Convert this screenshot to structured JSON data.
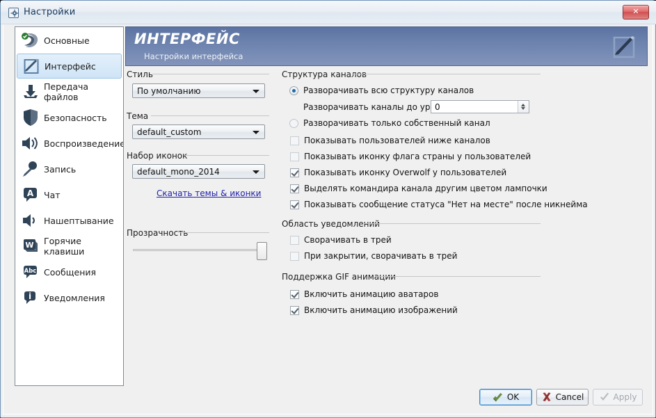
{
  "window": {
    "title": "Настройки",
    "title_icon": "settings-gear-icon",
    "close_label": "✕"
  },
  "sidebar": {
    "items": [
      {
        "label": "Основные",
        "icon": "teamspeak-logo-icon"
      },
      {
        "label": "Интерфейс",
        "icon": "pencil-edit-icon",
        "selected": true
      },
      {
        "label": "Передача файлов",
        "icon": "download-arrow-icon"
      },
      {
        "label": "Безопасность",
        "icon": "shield-icon"
      },
      {
        "label": "Воспроизведение",
        "icon": "speaker-icon"
      },
      {
        "label": "Запись",
        "icon": "microphone-icon"
      },
      {
        "label": "Чат",
        "icon": "chat-bubble-a-icon"
      },
      {
        "label": "Нашептывание",
        "icon": "whisper-speaker-icon"
      },
      {
        "label": "Горячие клавиши",
        "icon": "keyboard-w-key-icon"
      },
      {
        "label": "Сообщения",
        "icon": "abc-bubble-icon"
      },
      {
        "label": "Уведомления",
        "icon": "info-bubble-icon"
      }
    ]
  },
  "banner": {
    "title": "ИНТЕРФЕЙС",
    "subtitle": "Настройки интерфейса",
    "icon": "pencil-edit-icon"
  },
  "left_panel": {
    "style_group": "Стиль",
    "style_value": "По умолчанию",
    "theme_group": "Тема",
    "theme_value": "default_custom",
    "iconset_group": "Набор иконок",
    "iconset_value": "default_mono_2014",
    "download_link": "Скачать темы & иконки",
    "transparency_group": "Прозрачность",
    "transparency_value": 100
  },
  "channel_group": {
    "title": "Структура каналов",
    "radios": [
      {
        "label": "Разворачивать всю структуру каналов",
        "checked": true
      },
      {
        "label": "Разворачивать только собственный канал",
        "checked": false
      }
    ],
    "depth_label": "Разворачивать каналы до уровня:",
    "depth_value": "0",
    "checkboxes": [
      {
        "label": "Показывать пользователей ниже каналов",
        "checked": false
      },
      {
        "label": "Показывать иконку флага страны у пользователей",
        "checked": false
      },
      {
        "label": "Показывать иконку Overwolf у пользователей",
        "checked": true
      },
      {
        "label": "Выделять командира канала другим цветом лампочки",
        "checked": true
      },
      {
        "label": "Показывать сообщение статуса \"Нет на месте\" после никнейма",
        "checked": true
      }
    ]
  },
  "tray_group": {
    "title": "Область уведомлений",
    "checkboxes": [
      {
        "label": "Сворачивать в трей",
        "checked": false
      },
      {
        "label": "При закрытии, сворачивать в трей",
        "checked": false
      }
    ]
  },
  "gif_group": {
    "title": "Поддержка GIF анимации",
    "checkboxes": [
      {
        "label": "Включить анимацию аватаров",
        "checked": true
      },
      {
        "label": "Включить анимацию изображений",
        "checked": true
      }
    ]
  },
  "footer": {
    "ok": "OK",
    "cancel": "Cancel",
    "apply": "Apply",
    "ok_icon": "green-check-tag-icon",
    "cancel_icon": "red-x-icon",
    "apply_icon": "gray-check-icon"
  },
  "colors": {
    "banner_start": "#5b73a2",
    "banner_end": "#8494bb",
    "accent_blue": "#3c83c2",
    "link_blue": "#2222aa",
    "close_red": "#cf4f4f"
  }
}
